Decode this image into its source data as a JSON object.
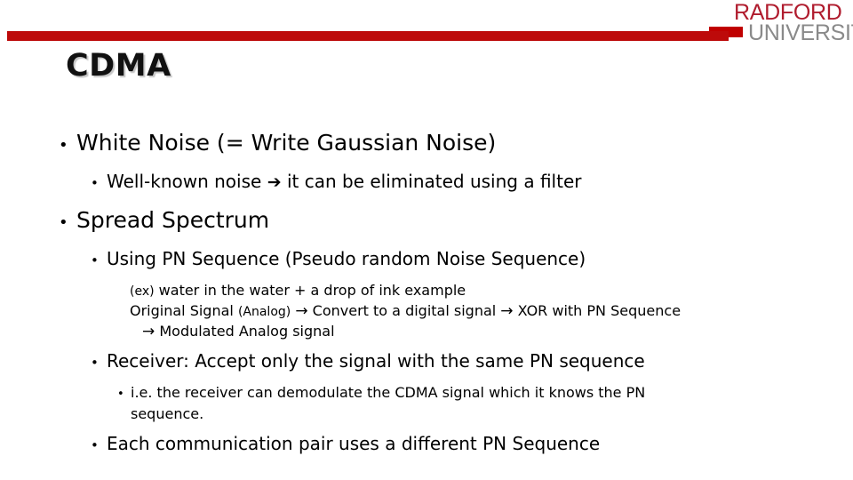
{
  "logo": {
    "word1": "RADFORD",
    "word2": "UNIVERSITY",
    "word1_color": "#b01c2e",
    "word2_color": "#8a8a8a",
    "mark_color": "#c00000"
  },
  "rule": {
    "color": "#bd0a0a"
  },
  "title": "CDMA",
  "content": {
    "white_noise": "White Noise (= Write Gaussian Noise)",
    "well_known": {
      "before": "Well-known noise",
      "arrow": "➔",
      "after": "it can be eliminated using a filter"
    },
    "spread_spectrum": "Spread Spectrum",
    "using_pn": "Using PN Sequence (Pseudo random Noise Sequence)",
    "ex_example": {
      "label": "(ex)",
      "text": "water in the water + a drop of ink example"
    },
    "signal_chain": {
      "part1": "Original Signal",
      "paren": "(Analog)",
      "arrow1": "→",
      "part2": "Convert to a digital signal",
      "arrow2": "→",
      "part3": "XOR with PN Sequence",
      "arrow3": "→",
      "part4": "Modulated Analog signal"
    },
    "receiver": "Receiver: Accept only the signal with the same PN sequence",
    "receiver_detail_line1": "i.e. the receiver can demodulate the CDMA signal which it knows the PN",
    "receiver_detail_line2": "sequence.",
    "each_pair": "Each communication pair uses a different PN Sequence"
  },
  "bullets": {
    "dot": "•"
  }
}
